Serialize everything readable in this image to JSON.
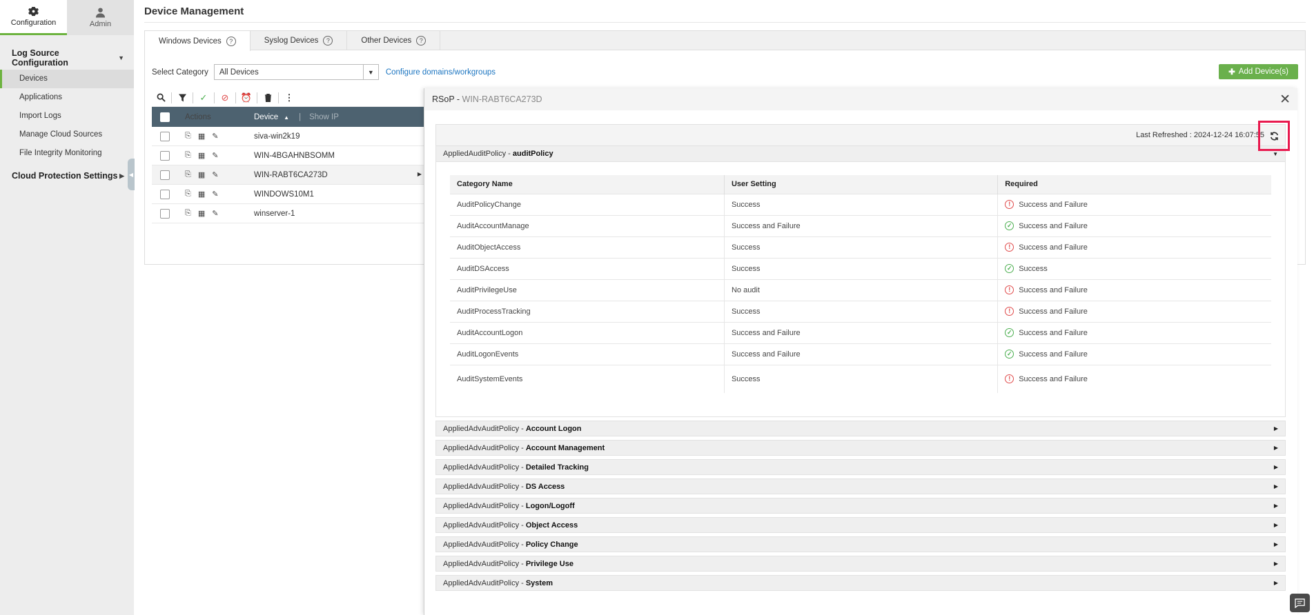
{
  "sidebar": {
    "top_tabs": [
      {
        "label": "Configuration",
        "icon": "gear-icon"
      },
      {
        "label": "Admin",
        "icon": "user-icon"
      }
    ],
    "section1": {
      "title": "Log Source Configuration",
      "items": [
        "Devices",
        "Applications",
        "Import Logs",
        "Manage Cloud Sources",
        "File Integrity Monitoring"
      ]
    },
    "section2": {
      "title": "Cloud Protection Settings"
    }
  },
  "main": {
    "title": "Device Management",
    "tabs": [
      "Windows Devices",
      "Syslog Devices",
      "Other Devices"
    ],
    "help_glyph": "?",
    "select_category_label": "Select Category",
    "select_value": "All Devices",
    "configure_link": "Configure domains/workgroups",
    "add_button": "Add Device(s)",
    "grid": {
      "col_actions": "Actions",
      "col_device": "Device",
      "show_ip": "Show IP",
      "rows": [
        "siva-win2k19",
        "WIN-4BGAHNBSOMM",
        "WIN-RABT6CA273D",
        "WINDOWS10M1",
        "winserver-1"
      ]
    }
  },
  "panel": {
    "title": "RSoP - ",
    "host": "WIN-RABT6CA273D",
    "last_refreshed": "Last Refreshed : 2024-12-24 16:07:55",
    "open_section": {
      "prefix": "AppliedAuditPolicy - ",
      "name": "auditPolicy"
    },
    "table": {
      "headers": [
        "Category Name",
        "User Setting",
        "Required"
      ],
      "rows": [
        {
          "name": "AuditPolicyChange",
          "setting": "Success",
          "required": "Success and Failure",
          "status": "error"
        },
        {
          "name": "AuditAccountManage",
          "setting": "Success and Failure",
          "required": "Success and Failure",
          "status": "ok"
        },
        {
          "name": "AuditObjectAccess",
          "setting": "Success",
          "required": "Success and Failure",
          "status": "error"
        },
        {
          "name": "AuditDSAccess",
          "setting": "Success",
          "required": "Success",
          "status": "ok"
        },
        {
          "name": "AuditPrivilegeUse",
          "setting": "No audit",
          "required": "Success and Failure",
          "status": "error"
        },
        {
          "name": "AuditProcessTracking",
          "setting": "Success",
          "required": "Success and Failure",
          "status": "error"
        },
        {
          "name": "AuditAccountLogon",
          "setting": "Success and Failure",
          "required": "Success and Failure",
          "status": "ok"
        },
        {
          "name": "AuditLogonEvents",
          "setting": "Success and Failure",
          "required": "Success and Failure",
          "status": "ok"
        },
        {
          "name": "AuditSystemEvents",
          "setting": "Success",
          "required": "Success and Failure",
          "status": "error"
        }
      ]
    },
    "collapsed_sections": [
      {
        "prefix": "AppliedAdvAuditPolicy - ",
        "name": "Account Logon"
      },
      {
        "prefix": "AppliedAdvAuditPolicy - ",
        "name": "Account Management"
      },
      {
        "prefix": "AppliedAdvAuditPolicy - ",
        "name": "Detailed Tracking"
      },
      {
        "prefix": "AppliedAdvAuditPolicy - ",
        "name": "DS Access"
      },
      {
        "prefix": "AppliedAdvAuditPolicy - ",
        "name": "Logon/Logoff"
      },
      {
        "prefix": "AppliedAdvAuditPolicy - ",
        "name": "Object Access"
      },
      {
        "prefix": "AppliedAdvAuditPolicy - ",
        "name": "Policy Change"
      },
      {
        "prefix": "AppliedAdvAuditPolicy - ",
        "name": "Privilege Use"
      },
      {
        "prefix": "AppliedAdvAuditPolicy - ",
        "name": "System"
      }
    ]
  },
  "colors": {
    "accent": "#6db33f",
    "grid_header": "#4d6270",
    "highlight": "#e8194e",
    "error": "#e04a4a",
    "ok": "#4caf50"
  }
}
